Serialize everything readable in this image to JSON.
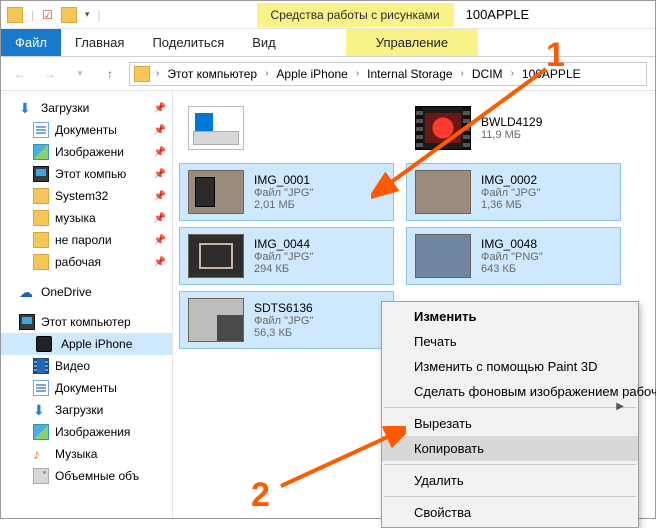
{
  "titlebar": {
    "tools_label": "Средства работы с рисунками",
    "title": "100APPLE"
  },
  "tabs": {
    "file": "Файл",
    "home": "Главная",
    "share": "Поделиться",
    "view": "Вид",
    "manage": "Управление"
  },
  "breadcrumb": {
    "segments": [
      "Этот компьютер",
      "Apple iPhone",
      "Internal Storage",
      "DCIM",
      "100APPLE"
    ]
  },
  "sidebar": {
    "quick_access": "Загрузки",
    "items_pinned": [
      {
        "icon": "doc",
        "label": "Документы"
      },
      {
        "icon": "img",
        "label": "Изображени"
      },
      {
        "icon": "pc",
        "label": "Этот компью"
      },
      {
        "icon": "folder",
        "label": "System32"
      },
      {
        "icon": "folder",
        "label": "музыка"
      },
      {
        "icon": "folder",
        "label": "не пароли"
      },
      {
        "icon": "folder",
        "label": "рабочая"
      }
    ],
    "onedrive": "OneDrive",
    "this_pc": "Этот компьютер",
    "this_pc_items": [
      {
        "icon": "phone",
        "label": "Apple iPhone",
        "selected": true
      },
      {
        "icon": "video",
        "label": "Видео"
      },
      {
        "icon": "doc",
        "label": "Документы"
      },
      {
        "icon": "dl",
        "label": "Загрузки"
      },
      {
        "icon": "img",
        "label": "Изображения"
      },
      {
        "icon": "music",
        "label": "Музыка"
      },
      {
        "icon": "drive",
        "label": "Объемные объ"
      }
    ]
  },
  "files": [
    {
      "thumb": "drive",
      "name": "",
      "type": "",
      "size": ""
    },
    {
      "thumb": "film",
      "name": "BWLD4129",
      "type": "",
      "size": "11,9 МБ"
    },
    {
      "thumb": "img1",
      "name": "IMG_0001",
      "type": "Файл \"JPG\"",
      "size": "2,01 МБ",
      "selected": true
    },
    {
      "thumb": "plain",
      "name": "IMG_0002",
      "type": "Файл \"JPG\"",
      "size": "1,36 МБ",
      "selected": true
    },
    {
      "thumb": "img44",
      "name": "IMG_0044",
      "type": "Файл \"JPG\"",
      "size": "294 КБ",
      "selected": true
    },
    {
      "thumb": "img48",
      "name": "IMG_0048",
      "type": "Файл \"PNG\"",
      "size": "643 КБ",
      "selected": true
    },
    {
      "thumb": "sdts",
      "name": "SDTS6136",
      "type": "Файл \"JPG\"",
      "size": "56,3 КБ",
      "selected": true
    }
  ],
  "context_menu": {
    "items": [
      {
        "label": "Изменить",
        "bold": true
      },
      {
        "label": "Печать"
      },
      {
        "label": "Изменить с помощью Paint 3D"
      },
      {
        "label": "Сделать фоновым изображением рабочего стола",
        "arrow": true
      },
      {
        "sep": true
      },
      {
        "label": "Вырезать"
      },
      {
        "label": "Копировать",
        "hover": true
      },
      {
        "sep": true
      },
      {
        "label": "Удалить"
      },
      {
        "sep": true
      },
      {
        "label": "Свойства"
      }
    ]
  },
  "annotations": {
    "n1": "1",
    "n2": "2"
  }
}
